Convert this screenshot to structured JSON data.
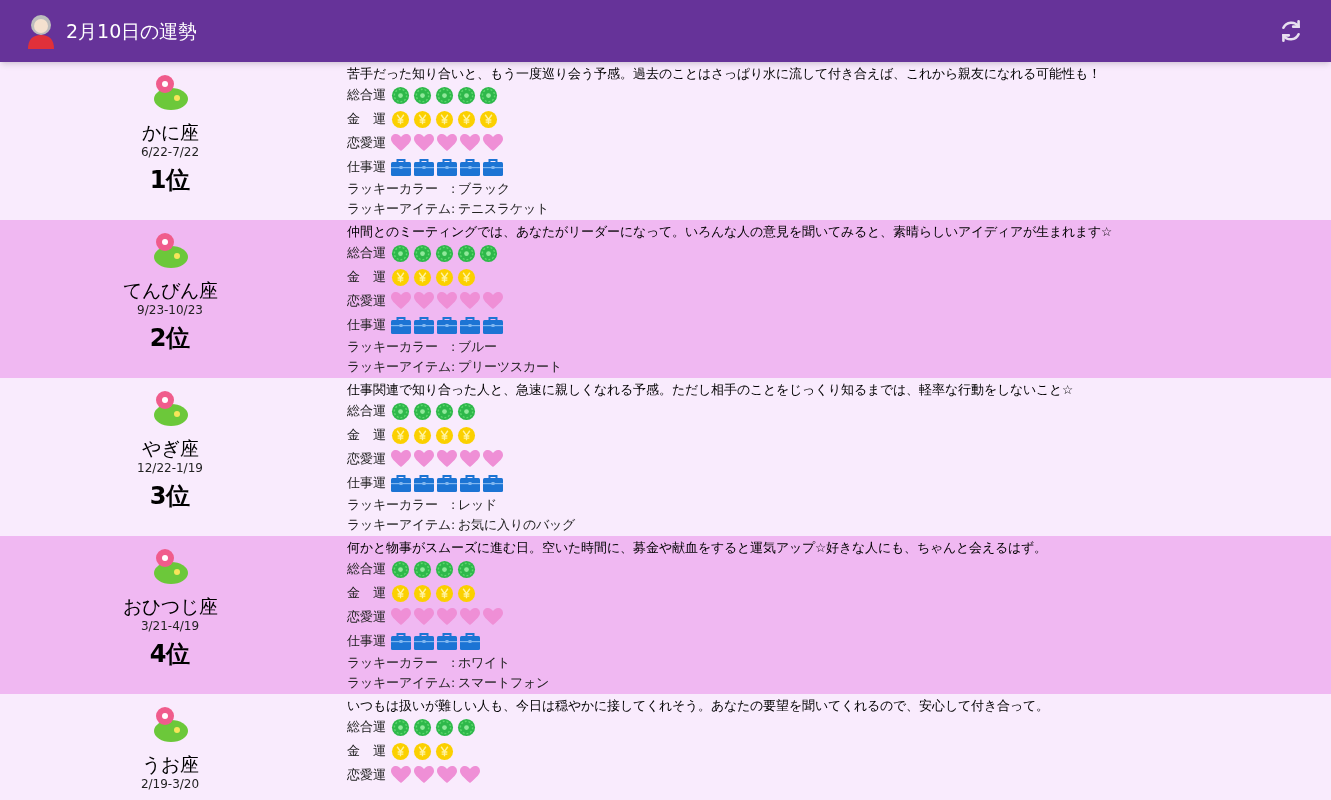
{
  "app_bar": {
    "title": "2月10日の運勢"
  },
  "signs": [
    {
      "name": "かに座",
      "dates": "6/22-7/22",
      "rank": "1位",
      "message": "苦手だった知り合いと、もう一度巡り会う予感。過去のことはさっぱり水に流して付き合えば、これから親友になれる可能性も！",
      "fortunes": [
        {
          "kind": "overall",
          "label": "総合運",
          "stars": 5
        },
        {
          "kind": "money",
          "label": "金　運",
          "stars": 5
        },
        {
          "kind": "love",
          "label": "恋愛運",
          "stars": 5
        },
        {
          "kind": "work",
          "label": "仕事運",
          "stars": 5
        }
      ],
      "lucky": [
        {
          "label": "ラッキーカラー　:",
          "value": "ブラック"
        },
        {
          "label": "ラッキーアイテム:",
          "value": "テニスラケット"
        }
      ]
    },
    {
      "name": "てんびん座",
      "dates": "9/23-10/23",
      "rank": "2位",
      "message": "仲間とのミーティングでは、あなたがリーダーになって。いろんな人の意見を聞いてみると、素晴らしいアイディアが生まれます☆",
      "fortunes": [
        {
          "kind": "overall",
          "label": "総合運",
          "stars": 5
        },
        {
          "kind": "money",
          "label": "金　運",
          "stars": 4
        },
        {
          "kind": "love",
          "label": "恋愛運",
          "stars": 5
        },
        {
          "kind": "work",
          "label": "仕事運",
          "stars": 5
        }
      ],
      "lucky": [
        {
          "label": "ラッキーカラー　:",
          "value": "ブルー"
        },
        {
          "label": "ラッキーアイテム:",
          "value": "プリーツスカート"
        }
      ]
    },
    {
      "name": "やぎ座",
      "dates": "12/22-1/19",
      "rank": "3位",
      "message": "仕事関連で知り合った人と、急速に親しくなれる予感。ただし相手のことをじっくり知るまでは、軽率な行動をしないこと☆",
      "fortunes": [
        {
          "kind": "overall",
          "label": "総合運",
          "stars": 4
        },
        {
          "kind": "money",
          "label": "金　運",
          "stars": 4
        },
        {
          "kind": "love",
          "label": "恋愛運",
          "stars": 5
        },
        {
          "kind": "work",
          "label": "仕事運",
          "stars": 5
        }
      ],
      "lucky": [
        {
          "label": "ラッキーカラー　:",
          "value": "レッド"
        },
        {
          "label": "ラッキーアイテム:",
          "value": "お気に入りのバッグ"
        }
      ]
    },
    {
      "name": "おひつじ座",
      "dates": "3/21-4/19",
      "rank": "4位",
      "message": "何かと物事がスムーズに進む日。空いた時間に、募金や献血をすると運気アップ☆好きな人にも、ちゃんと会えるはず。",
      "fortunes": [
        {
          "kind": "overall",
          "label": "総合運",
          "stars": 4
        },
        {
          "kind": "money",
          "label": "金　運",
          "stars": 4
        },
        {
          "kind": "love",
          "label": "恋愛運",
          "stars": 5
        },
        {
          "kind": "work",
          "label": "仕事運",
          "stars": 4
        }
      ],
      "lucky": [
        {
          "label": "ラッキーカラー　:",
          "value": "ホワイト"
        },
        {
          "label": "ラッキーアイテム:",
          "value": "スマートフォン"
        }
      ]
    },
    {
      "name": "うお座",
      "dates": "2/19-3/20",
      "message": "いつもは扱いが難しい人も、今日は穏やかに接してくれそう。あなたの要望を聞いてくれるので、安心して付き合って。",
      "fortunes": [
        {
          "kind": "overall",
          "label": "総合運",
          "stars": 4
        },
        {
          "kind": "money",
          "label": "金　運",
          "stars": 3
        },
        {
          "kind": "love",
          "label": "恋愛運",
          "stars": 4
        }
      ]
    }
  ]
}
